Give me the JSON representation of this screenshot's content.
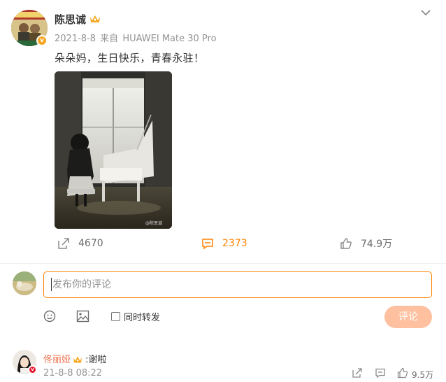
{
  "post": {
    "author": "陈思诚",
    "date": "2021-8-8",
    "source_prefix": "来自",
    "device": "HUAWEI Mate 30 Pro",
    "text": "朵朵妈，生日快乐，青春永驻！",
    "image_watermark": "@陈思诚"
  },
  "actions": {
    "repost_count": "4670",
    "comment_count": "2373",
    "like_count": "74.9万"
  },
  "composer": {
    "placeholder": "发布你的评论",
    "also_repost_label": "同时转发",
    "submit_label": "评论"
  },
  "comment": {
    "author": "佟丽娅",
    "text": ":谢啦",
    "time": "21-8-8 08:22",
    "like_count": "9.5万"
  },
  "colors": {
    "accent": "#ff8200",
    "submit_disabled": "#ffc09f",
    "meta_gray": "#939393",
    "comment_name": "#eb7350",
    "verified_gold": "#f6a623",
    "verified_red": "#e6162d"
  },
  "icons": [
    "chevron-down-icon",
    "crown-icon",
    "repost-icon",
    "comment-icon",
    "like-icon",
    "emoji-icon",
    "image-icon"
  ]
}
